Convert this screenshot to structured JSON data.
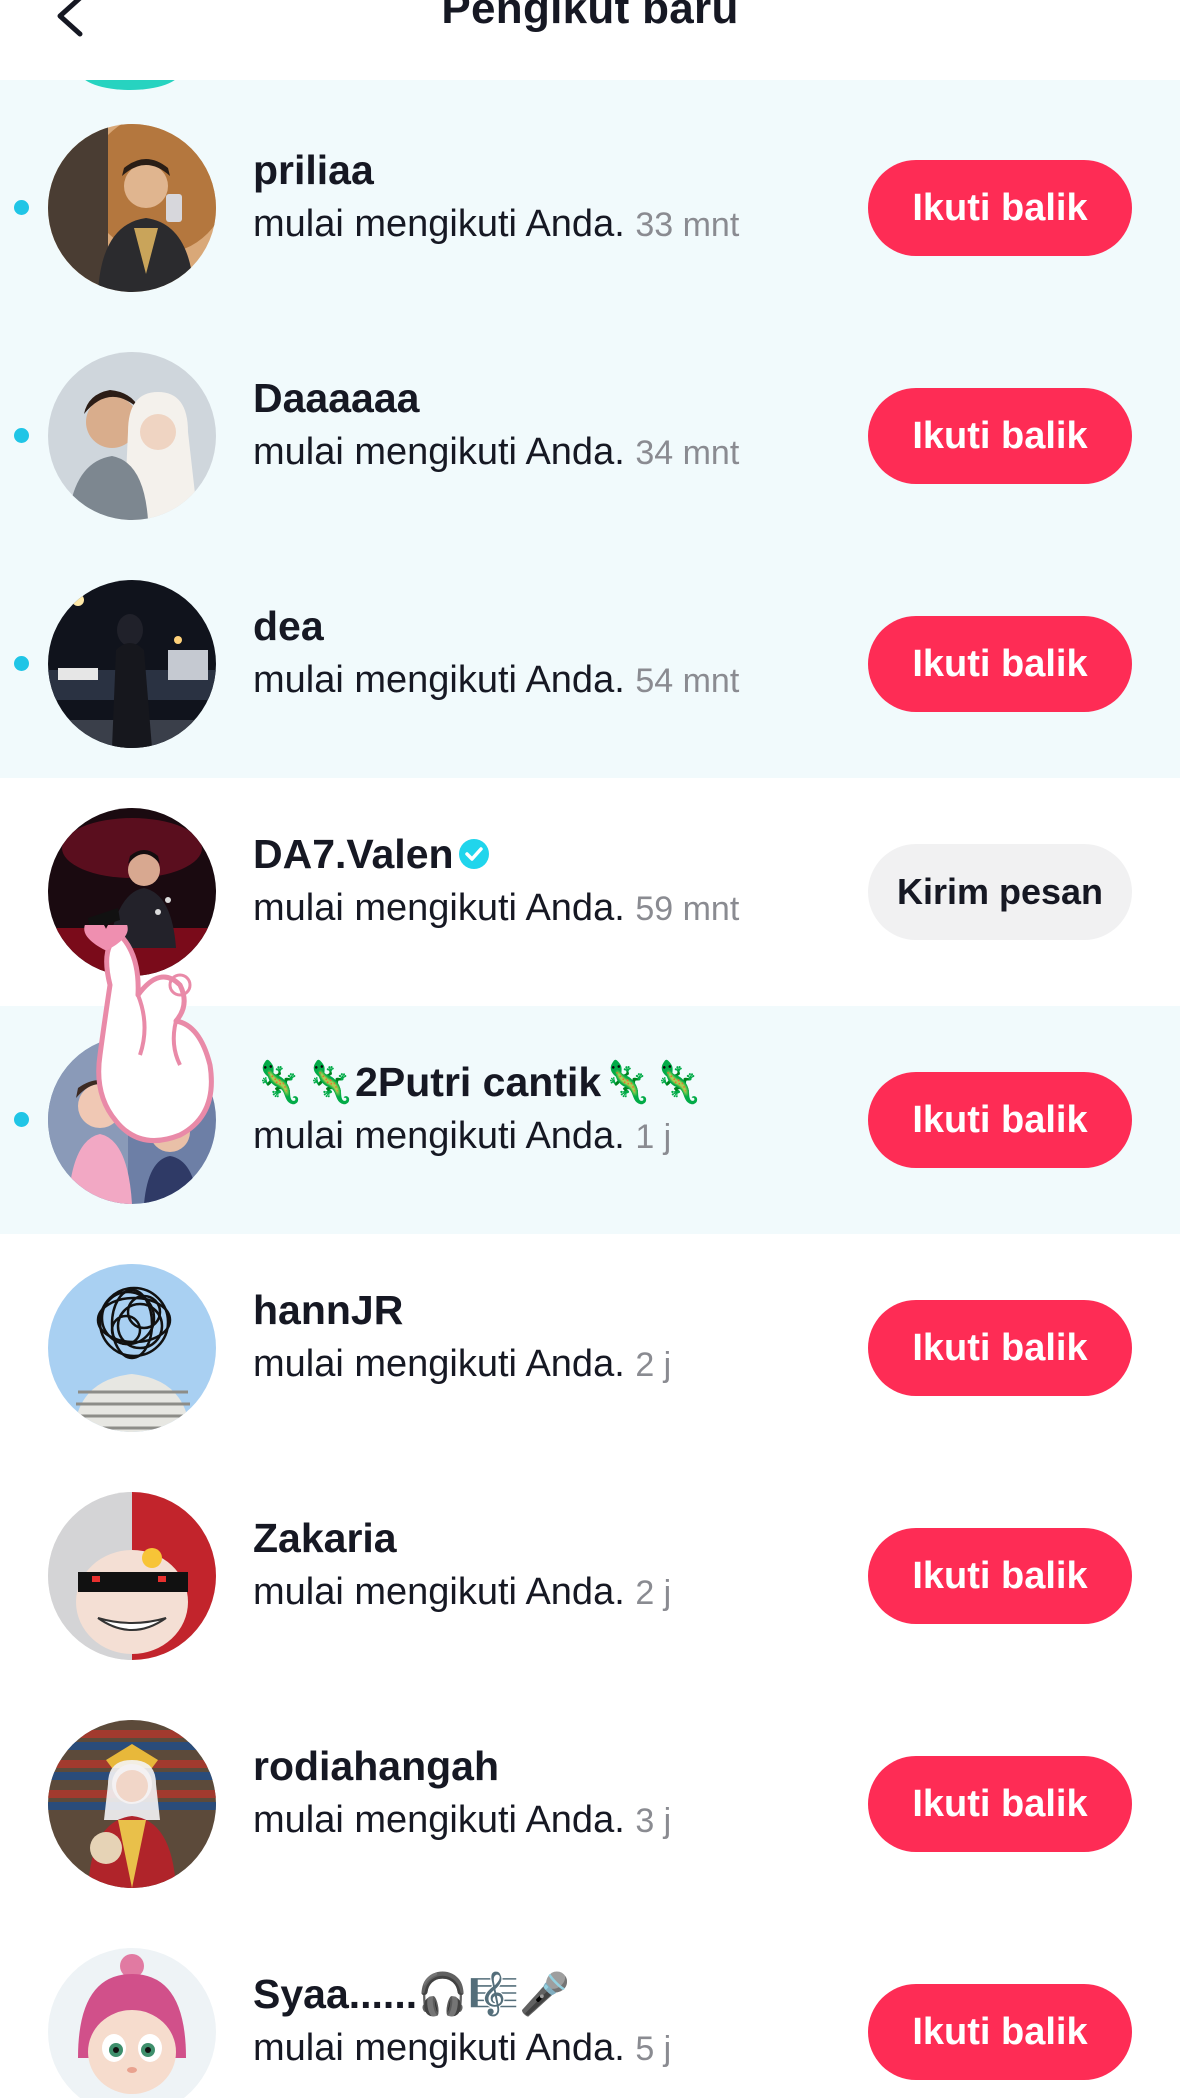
{
  "header": {
    "title": "Pengikut baru",
    "back_icon": "chevron-left-icon"
  },
  "colors": {
    "accent": "#fe2c55",
    "unread_bg": "#f1fafc",
    "unread_dot": "#20c5e6",
    "verified": "#20d5ec"
  },
  "followers": [
    {
      "username": "priliaa",
      "action": "mulai mengikuti Anda.",
      "time": "33 mnt",
      "button": "Ikuti balik",
      "unread": true
    },
    {
      "username": "Daaaaaa",
      "action": "mulai mengikuti Anda.",
      "time": "34 mnt",
      "button": "Ikuti balik",
      "unread": true
    },
    {
      "username": "dea",
      "action": "mulai mengikuti Anda.",
      "time": "54 mnt",
      "button": "Ikuti balik",
      "unread": true
    },
    {
      "username": "DA7.Valen",
      "verified": true,
      "action": "mulai mengikuti Anda.",
      "time": "59 mnt",
      "button": "Kirim pesan",
      "unread": false
    },
    {
      "username": "🦎🦎2Putri cantik🦎🦎",
      "action": "mulai mengikuti Anda.",
      "time": "1 j",
      "button": "Ikuti balik",
      "unread": true
    },
    {
      "username": "hannJR",
      "action": "mulai mengikuti Anda.",
      "time": "2 j",
      "button": "Ikuti balik",
      "unread": false
    },
    {
      "username": "Zakaria",
      "action": "mulai mengikuti Anda.",
      "time": "2 j",
      "button": "Ikuti balik",
      "unread": false
    },
    {
      "username": "rodiahangah",
      "action": "mulai mengikuti Anda.",
      "time": "3 j",
      "button": "Ikuti balik",
      "unread": false
    },
    {
      "username": "Syaa......🎧🎼🎤",
      "action": "mulai mengikuti Anda.",
      "time": "5 j",
      "button": "Ikuti balik",
      "unread": false
    }
  ]
}
